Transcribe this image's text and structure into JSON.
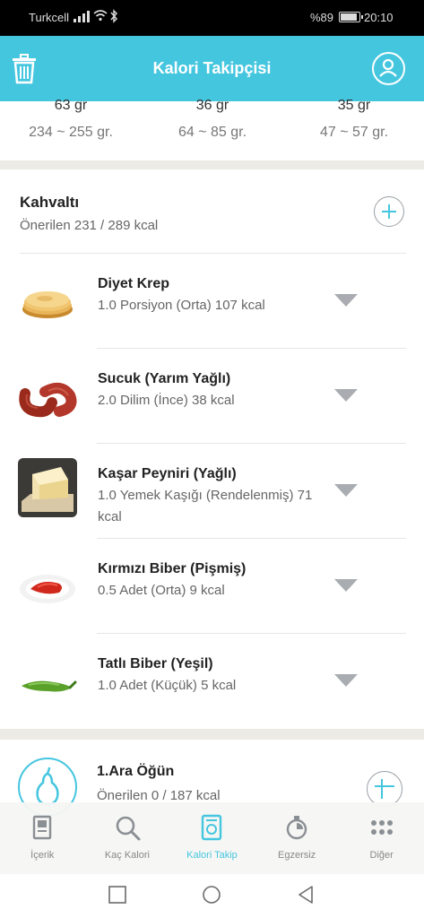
{
  "status_bar": {
    "carrier": "Turkcell",
    "battery_percent": "%89",
    "time": "20:10"
  },
  "header": {
    "title": "Kalori Takipçisi"
  },
  "macros": [
    {
      "amount": "63 gr",
      "range": "234 ~ 255 gr."
    },
    {
      "amount": "36 gr",
      "range": "64 ~ 85 gr."
    },
    {
      "amount": "35 gr",
      "range": "47 ~ 57 gr."
    }
  ],
  "meal": {
    "title": "Kahvaltı",
    "recommended": "Önerilen 231 / 289 kcal",
    "items": [
      {
        "name": "Diyet Krep",
        "detail": "1.0 Porsiyon (Orta) 107 kcal"
      },
      {
        "name": "Sucuk (Yarım Yağlı)",
        "detail": "2.0 Dilim (İnce) 38 kcal"
      },
      {
        "name": "Kaşar Peyniri (Yağlı)",
        "detail": "1.0 Yemek Kaşığı (Rendelenmiş) 71 kcal"
      },
      {
        "name": "Kırmızı Biber (Pişmiş)",
        "detail": "0.5 Adet (Orta) 9 kcal"
      },
      {
        "name": "Tatlı Biber (Yeşil)",
        "detail": "1.0 Adet (Küçük) 5 kcal"
      }
    ]
  },
  "snack": {
    "title": "1.Ara Öğün",
    "recommended": "Önerilen 0 / 187 kcal"
  },
  "tabs": [
    {
      "label": "İçerik",
      "icon": "book-icon"
    },
    {
      "label": "Kaç Kalori",
      "icon": "search-icon"
    },
    {
      "label": "Kalori Takip",
      "icon": "scale-icon",
      "active": true
    },
    {
      "label": "Egzersiz",
      "icon": "stopwatch-icon"
    },
    {
      "label": "Diğer",
      "icon": "more-dots-icon"
    }
  ],
  "colors": {
    "accent": "#45c6df",
    "band": "#ecebe6",
    "caret": "#a9adb1"
  }
}
